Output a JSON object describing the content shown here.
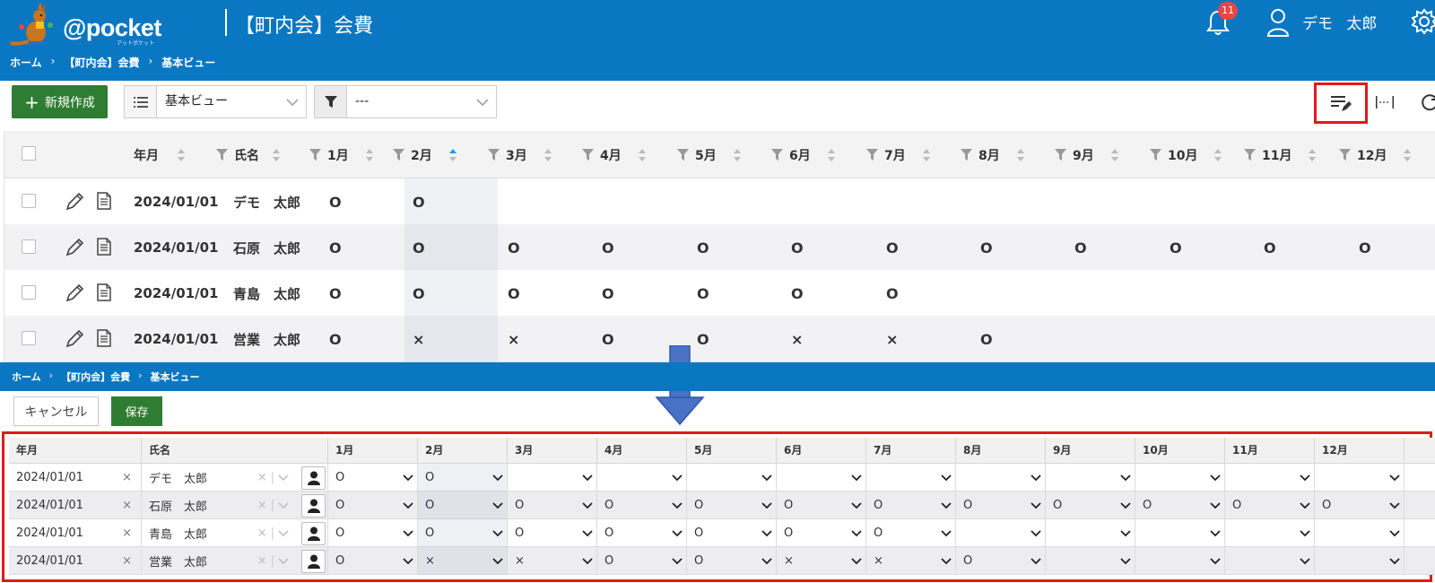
{
  "header": {
    "logo_text": "@pocket",
    "logo_sub": "アットポケット",
    "app_title": "【町内会】会費",
    "notification_count": "11",
    "user_name": "デモ 太郎"
  },
  "breadcrumb": [
    "ホーム",
    "【町内会】会費",
    "基本ビュー"
  ],
  "breadcrumb_sep": "›",
  "toolbar": {
    "new_label": "新規作成",
    "view_value": "基本ビュー",
    "filter_value": "---"
  },
  "table": {
    "headers": [
      "年月",
      "氏名",
      "1月",
      "2月",
      "3月",
      "4月",
      "5月",
      "6月",
      "7月",
      "8月",
      "9月",
      "10月",
      "11月",
      "12月"
    ],
    "rows": [
      {
        "date": "2024/01/01",
        "name": "デモ　太郎",
        "months": [
          "O",
          "O",
          "",
          "",
          "",
          "",
          "",
          "",
          "",
          "",
          "",
          ""
        ]
      },
      {
        "date": "2024/01/01",
        "name": "石原　太郎",
        "months": [
          "O",
          "O",
          "O",
          "O",
          "O",
          "O",
          "O",
          "O",
          "O",
          "O",
          "O",
          "O"
        ]
      },
      {
        "date": "2024/01/01",
        "name": "青島　太郎",
        "months": [
          "O",
          "O",
          "O",
          "O",
          "O",
          "O",
          "O",
          "",
          "",
          "",
          "",
          ""
        ]
      },
      {
        "date": "2024/01/01",
        "name": "営業　太郎",
        "months": [
          "O",
          "×",
          "×",
          "O",
          "O",
          "×",
          "×",
          "O",
          "",
          "",
          "",
          ""
        ]
      }
    ]
  },
  "edit": {
    "cancel_label": "キャンセル",
    "save_label": "保存",
    "clear_glyph": "×"
  },
  "colors": {
    "brand_blue": "#0a77c2",
    "new_button_green": "#2e7d32",
    "highlight_red": "#e01b1b",
    "badge_red": "#e84545"
  },
  "icons": [
    "kangaroo-logo",
    "bell-icon",
    "user-icon",
    "gear-icon",
    "list-icon",
    "funnel-icon",
    "chevron-down-icon",
    "edit-list-icon",
    "fit-width-icon",
    "refresh-icon",
    "pencil-icon",
    "document-icon",
    "person-icon",
    "down-arrow"
  ]
}
